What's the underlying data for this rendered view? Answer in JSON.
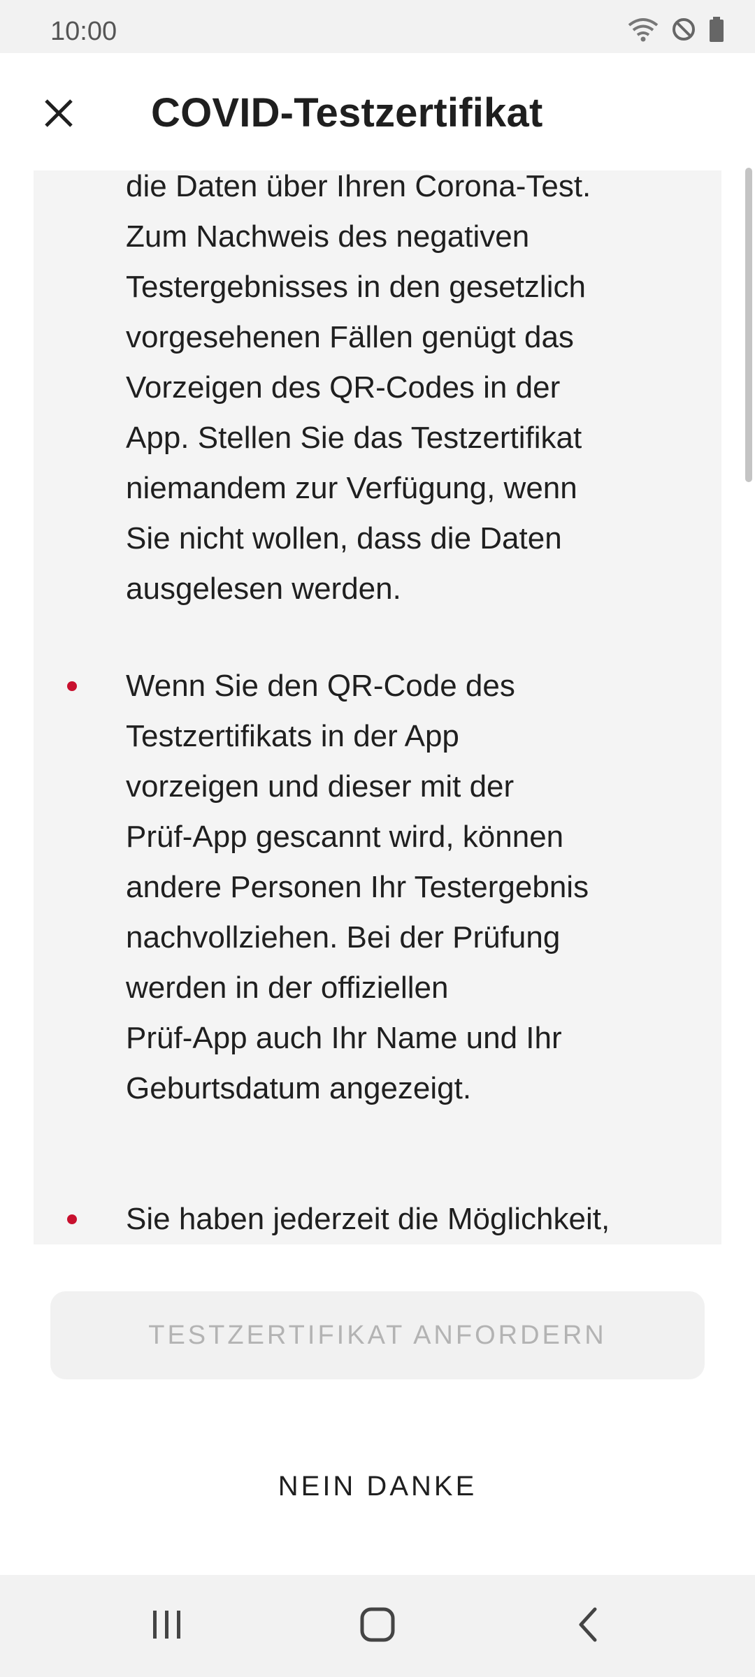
{
  "status_bar": {
    "time": "10:00",
    "icons": [
      "wifi-icon",
      "do-not-disturb-icon",
      "battery-icon"
    ]
  },
  "app_bar": {
    "close_icon": "close-icon",
    "title": "COVID-Testzertifikat"
  },
  "content": {
    "paragraphs": [
      {
        "bullet": false,
        "lines": [
          "die Daten über Ihren Corona-Test.",
          "Zum Nachweis des negativen",
          "Testergebnisses in den gesetzlich",
          "vorgesehenen Fällen genügt das",
          "Vorzeigen des QR-Codes in der",
          "App. Stellen Sie das Testzertifikat",
          "niemandem zur Verfügung, wenn",
          "Sie nicht wollen, dass die Daten",
          "ausgelesen werden."
        ]
      },
      {
        "bullet": true,
        "lines": [
          "Wenn Sie den QR-Code des",
          "Testzertifikats in der App",
          "vorzeigen und dieser mit der",
          "Prüf-App gescannt wird, können",
          "andere Personen Ihr Testergebnis",
          "nachvollziehen. Bei der Prüfung",
          "werden in der offiziellen",
          "Prüf-App auch Ihr Name und Ihr",
          "Geburtsdatum angezeigt."
        ]
      },
      {
        "bullet": true,
        "lines": [
          "Sie haben jederzeit die Möglichkeit,"
        ]
      }
    ],
    "bullet_color": "#c8102e"
  },
  "buttons": {
    "request_label": "TESTZERTIFIKAT ANFORDERN",
    "decline_label": "NEIN DANKE"
  },
  "nav_bar": {
    "icons": [
      "recent-apps-icon",
      "home-icon",
      "back-icon"
    ]
  }
}
